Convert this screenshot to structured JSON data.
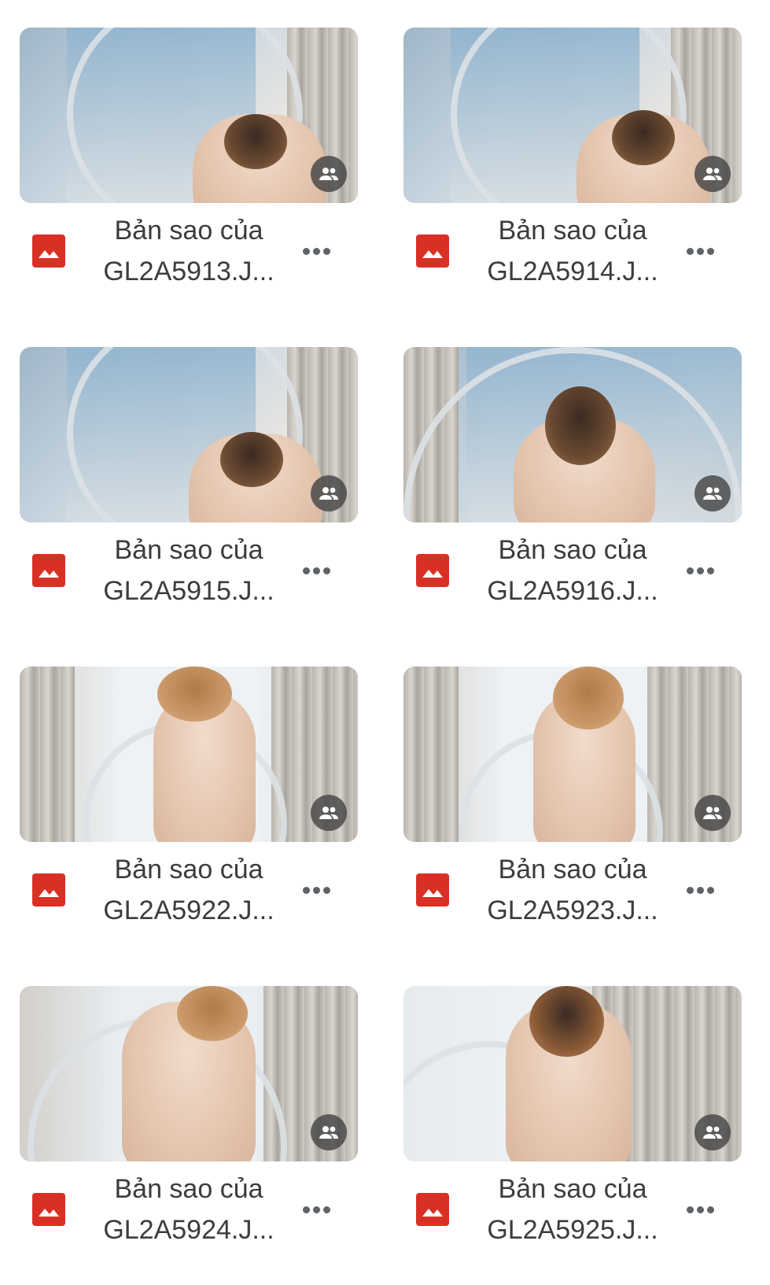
{
  "files": [
    {
      "line1": "Bản sao của",
      "line2": "GL2A5913.J...",
      "scene": "leg-up"
    },
    {
      "line1": "Bản sao của",
      "line2": "GL2A5914.J...",
      "scene": "leg-up"
    },
    {
      "line1": "Bản sao của",
      "line2": "GL2A5915.J...",
      "scene": "leg-up"
    },
    {
      "line1": "Bản sao của",
      "line2": "GL2A5916.J...",
      "scene": "front"
    },
    {
      "line1": "Bản sao của",
      "line2": "GL2A5922.J...",
      "scene": "back"
    },
    {
      "line1": "Bản sao của",
      "line2": "GL2A5923.J...",
      "scene": "back"
    },
    {
      "line1": "Bản sao của",
      "line2": "GL2A5924.J...",
      "scene": "back"
    },
    {
      "line1": "Bản sao của",
      "line2": "GL2A5925.J...",
      "scene": "back"
    }
  ],
  "icons": {
    "file_type": "image-file-icon",
    "shared": "shared-people-icon",
    "more": "more-options-icon"
  },
  "colors": {
    "file_icon": "#d93025",
    "text": "#3c3c3c",
    "dots": "#5f6368",
    "badge": "#464646"
  }
}
